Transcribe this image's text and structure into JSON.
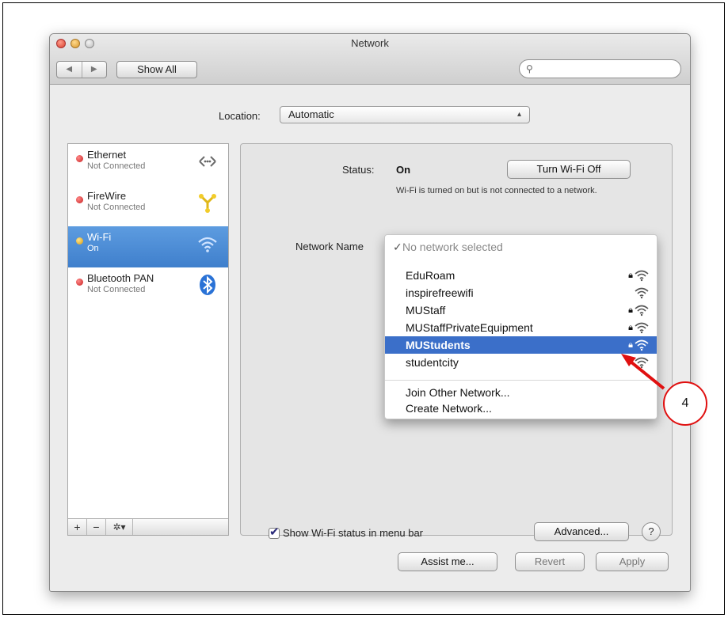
{
  "window": {
    "title": "Network"
  },
  "toolbar": {
    "back": "◀",
    "forward": "▶",
    "show_all": "Show All",
    "search_placeholder": ""
  },
  "location": {
    "label": "Location:",
    "value": "Automatic"
  },
  "services": [
    {
      "name": "Ethernet",
      "status": "Not Connected",
      "dot": "red",
      "icon": "ethernet-icon"
    },
    {
      "name": "FireWire",
      "status": "Not Connected",
      "dot": "red",
      "icon": "firewire-icon"
    },
    {
      "name": "Wi-Fi",
      "status": "On",
      "dot": "yellow",
      "icon": "wifi-icon",
      "selected": true
    },
    {
      "name": "Bluetooth PAN",
      "status": "Not Connected",
      "dot": "red",
      "icon": "bluetooth-icon"
    }
  ],
  "sidebar_tools": {
    "add": "+",
    "remove": "−",
    "gear": "✲▾"
  },
  "status": {
    "label": "Status:",
    "value": "On",
    "button": "Turn Wi-Fi Off",
    "description": "Wi-Fi is turned on but is not connected to a network."
  },
  "network_name": {
    "label": "Network Name"
  },
  "dropdown": {
    "selected": "No network selected",
    "networks": [
      {
        "name": "EduRoam",
        "locked": true
      },
      {
        "name": "inspirefreewifi",
        "locked": false
      },
      {
        "name": "MUStaff",
        "locked": true
      },
      {
        "name": "MUStaffPrivateEquipment",
        "locked": true
      },
      {
        "name": "MUStudents",
        "locked": true,
        "highlighted": true
      },
      {
        "name": "studentcity",
        "locked": false
      }
    ],
    "join_other": "Join Other Network...",
    "create": "Create Network..."
  },
  "show_status": {
    "label": "Show Wi-Fi status in menu bar",
    "checked": true
  },
  "advanced_button": "Advanced...",
  "help_button": "?",
  "bottom_buttons": {
    "assist": "Assist me...",
    "revert": "Revert",
    "apply": "Apply"
  },
  "annotation": {
    "number": "4"
  },
  "colors": {
    "selection": "#3b6fc9",
    "callout": "#e01010"
  }
}
